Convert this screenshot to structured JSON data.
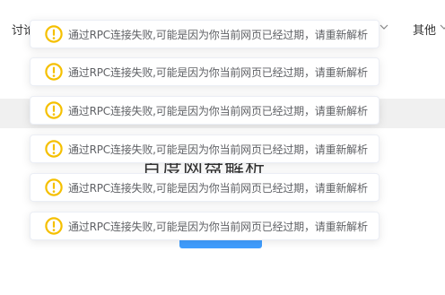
{
  "nav": {
    "left_label": "讨论",
    "other_label": "其他"
  },
  "main": {
    "title": "百度网盘解析",
    "button_label": ""
  },
  "toasts": [
    {
      "message": "通过RPC连接失败,可能是因为你当前网页已经过期，请重新解析",
      "icon": "warning-icon"
    },
    {
      "message": "通过RPC连接失败,可能是因为你当前网页已经过期，请重新解析",
      "icon": "warning-icon"
    },
    {
      "message": "通过RPC连接失败,可能是因为你当前网页已经过期，请重新解析",
      "icon": "warning-icon"
    },
    {
      "message": "通过RPC连接失败,可能是因为你当前网页已经过期，请重新解析",
      "icon": "warning-icon"
    },
    {
      "message": "通过RPC连接失败,可能是因为你当前网页已经过期，请重新解析",
      "icon": "warning-icon"
    },
    {
      "message": "通过RPC连接失败,可能是因为你当前网页已经过期，请重新解析",
      "icon": "warning-icon"
    }
  ],
  "colors": {
    "warning": "#f5c000",
    "primary": "#409eff",
    "toast_text": "#606266",
    "band": "#f0f0f0"
  }
}
